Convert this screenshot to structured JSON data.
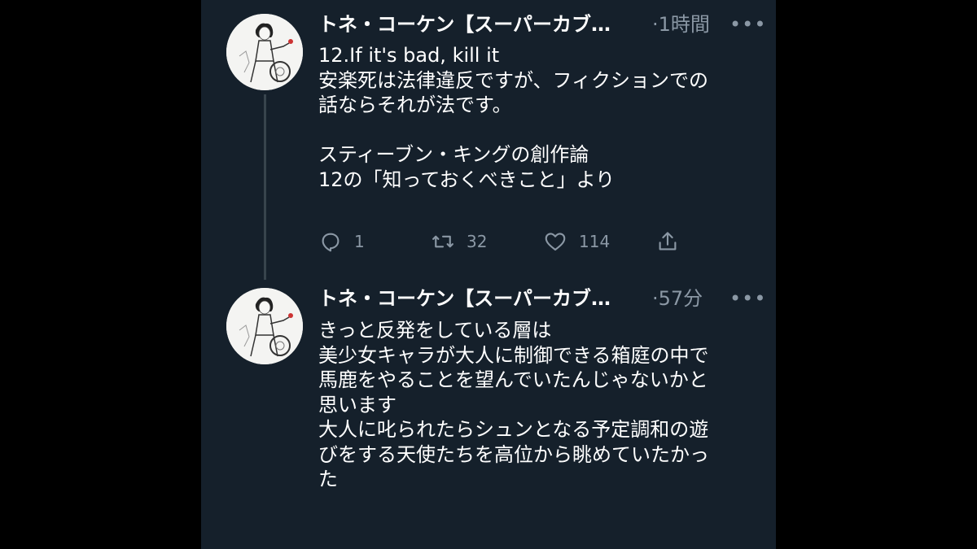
{
  "tweets": [
    {
      "display_name": "トネ・コーケン【スーパーカブ…",
      "time": "·1時間",
      "more_label": "•••",
      "lines": [
        "12.If it's bad, kill it",
        "安楽死は法律違反ですが、フィクションでの",
        "話ならそれが法です。",
        "",
        "スティーブン・キングの創作論",
        "12の「知っておくべきこと」より"
      ],
      "reply_count": "1",
      "retweet_count": "32",
      "like_count": "114"
    },
    {
      "display_name": "トネ・コーケン【スーパーカブ…",
      "time": "·57分",
      "more_label": "•••",
      "lines": [
        "きっと反発をしている層は",
        "美少女キャラが大人に制御できる箱庭の中で",
        "馬鹿をやることを望んでいたんじゃないかと",
        "思います",
        "大人に叱られたらシュンとなる予定調和の遊",
        "びをする天使たちを高位から眺めていたかっ",
        "た"
      ]
    }
  ],
  "icons": {
    "reply": "reply-icon",
    "retweet": "retweet-icon",
    "like": "heart-icon",
    "share": "share-icon",
    "more": "more-icon"
  },
  "colors": {
    "background": "#15202b",
    "text": "#ffffff",
    "secondary": "#8b98a5",
    "thread_line": "#38444d"
  }
}
